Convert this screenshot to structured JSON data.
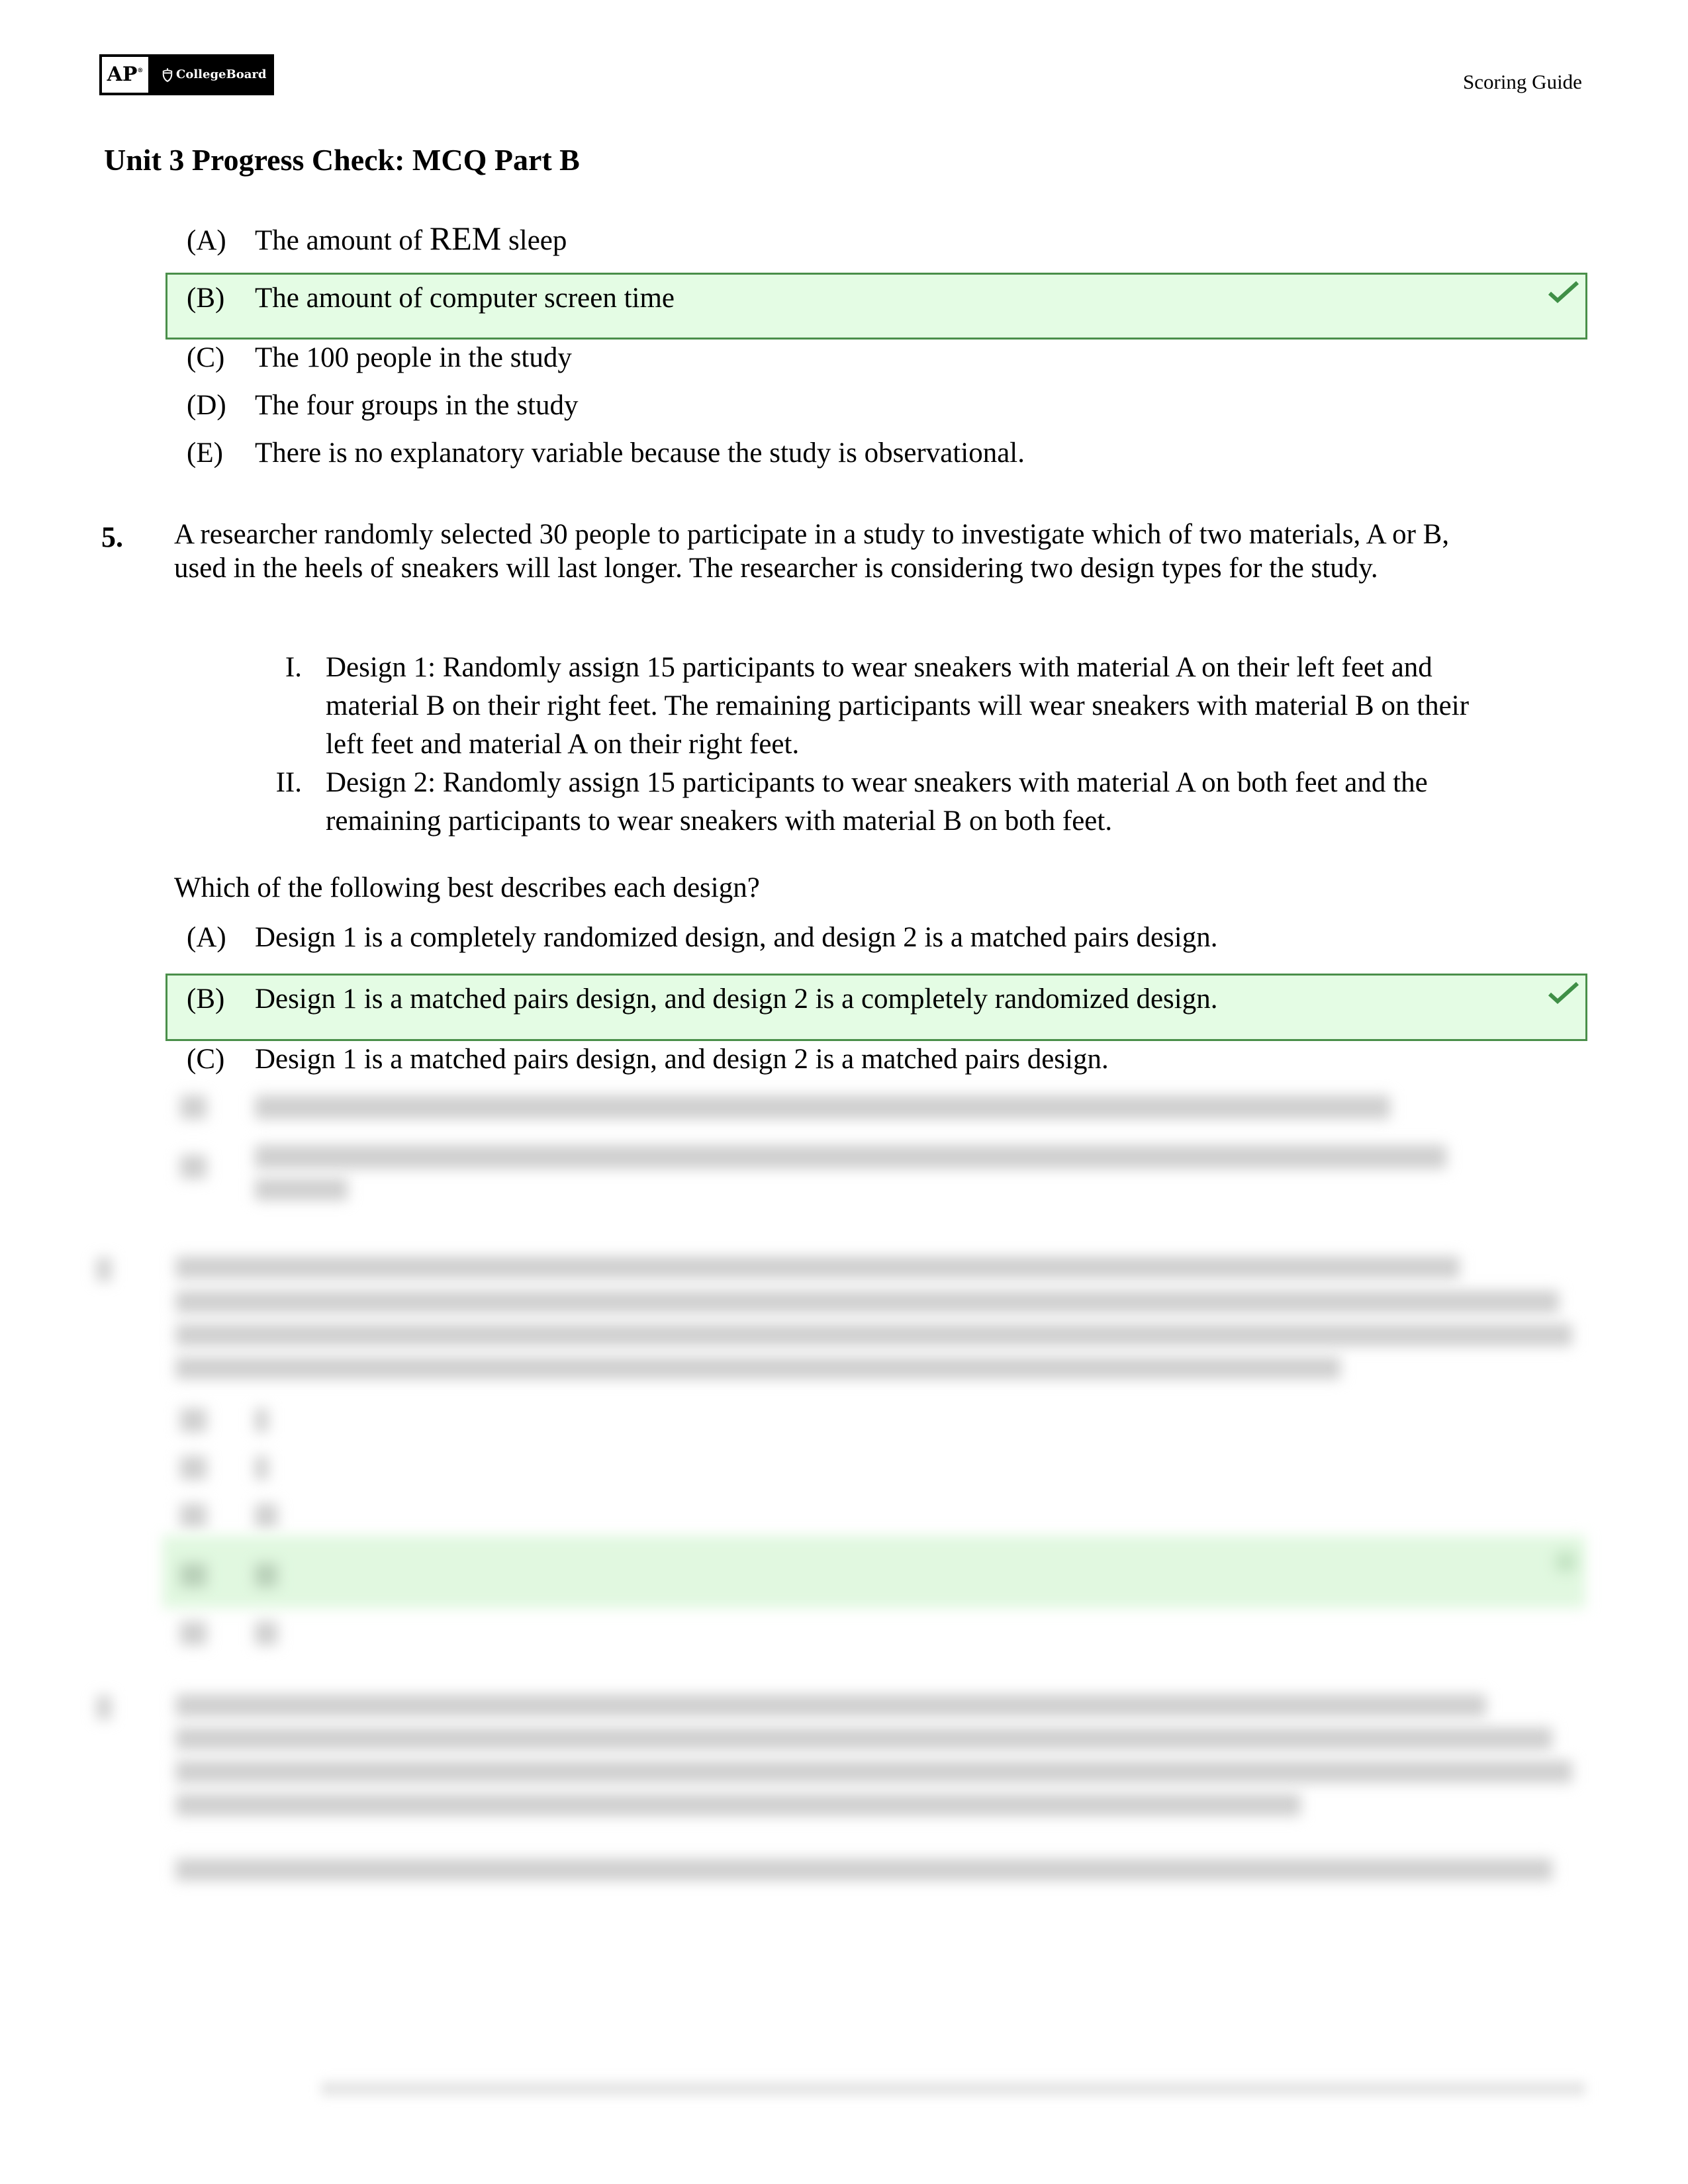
{
  "header": {
    "logo_ap": "AP",
    "logo_ap_mark": "®",
    "logo_brand": "CollegeBoard",
    "doc_type": "Scoring Guide"
  },
  "page_title": "Unit 3 Progress Check: MCQ Part B",
  "question4_continued": {
    "options": [
      {
        "label": "(A)",
        "text_prefix": "The amount of ",
        "text_emph": "REM",
        "text_suffix": " sleep",
        "correct": false
      },
      {
        "label": "(B)",
        "text": "The amount of computer screen time",
        "correct": true
      },
      {
        "label": "(C)",
        "text": "The 100 people in the study",
        "correct": false
      },
      {
        "label": "(D)",
        "text": "The four groups in the study",
        "correct": false
      },
      {
        "label": "(E)",
        "text": "There is no explanatory variable because the study is observational.",
        "correct": false
      }
    ]
  },
  "question5": {
    "number": "5.",
    "stem_line1": "A researcher randomly selected 30 people to participate in a study to investigate which of two materials, A or B,",
    "stem_line2": "used in the heels of sneakers will last longer. The researcher is considering two design types for the study.",
    "designs": [
      {
        "numeral": "I.",
        "lines": [
          "Design 1: Randomly assign 15 participants to wear sneakers with material A on their left feet and",
          "material B on their right feet. The remaining participants will wear sneakers with material B on their",
          "left feet and material A on their right feet."
        ]
      },
      {
        "numeral": "II.",
        "lines": [
          "Design 2: Randomly assign 15 participants to wear sneakers with material A on both feet and the",
          "remaining participants to wear sneakers with material B on both feet."
        ]
      }
    ],
    "prompt": "Which of the following best describes each design?",
    "options": [
      {
        "label": "(A)",
        "text": "Design 1 is a completely randomized design, and design 2 is a matched pairs design.",
        "correct": false
      },
      {
        "label": "(B)",
        "text": "Design 1 is a matched pairs design, and design 2 is a completely randomized design.",
        "correct": true
      },
      {
        "label": "(C)",
        "text": "Design 1 is a matched pairs design, and design 2 is a matched pairs design.",
        "correct": false
      }
    ]
  },
  "colors": {
    "correct_fill": "#e4fce4",
    "correct_border": "#4a8f4a",
    "check": "#3f8f46"
  },
  "icons": {
    "correct": "check-icon",
    "brand": "acorn-icon"
  }
}
